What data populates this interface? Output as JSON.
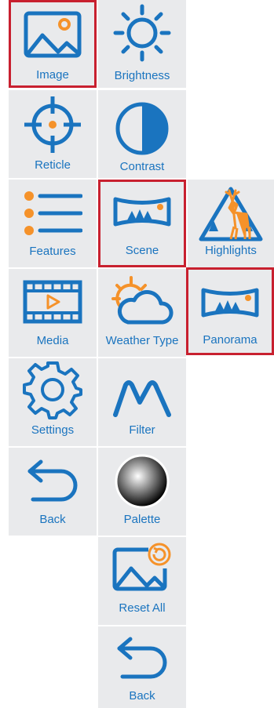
{
  "colors": {
    "blue": "#1a74bf",
    "orange": "#f5922a",
    "tile": "#e9eaec",
    "selected_border": "#c8202f"
  },
  "col1": {
    "image": {
      "label": "Image",
      "icon": "image-icon"
    },
    "reticle": {
      "label": "Reticle",
      "icon": "crosshair-icon"
    },
    "features": {
      "label": "Features",
      "icon": "list-icon"
    },
    "media": {
      "label": "Media",
      "icon": "film-icon"
    },
    "settings": {
      "label": "Settings",
      "icon": "gear-icon"
    },
    "back": {
      "label": "Back",
      "icon": "back-arrow-icon"
    }
  },
  "col2": {
    "brightness": {
      "label": "Brightness",
      "icon": "sun-icon"
    },
    "contrast": {
      "label": "Contrast",
      "icon": "contrast-icon"
    },
    "scene": {
      "label": "Scene",
      "icon": "scene-icon"
    },
    "weather": {
      "label": "Weather Type",
      "icon": "weather-icon"
    },
    "filter": {
      "label": "Filter",
      "icon": "filter-icon"
    },
    "palette": {
      "label": "Palette",
      "icon": "palette-icon"
    },
    "reset": {
      "label": "Reset All",
      "icon": "reset-image-icon"
    },
    "back": {
      "label": "Back",
      "icon": "back-arrow-icon"
    }
  },
  "col3": {
    "highlights": {
      "label": "Highlights",
      "icon": "deer-icon"
    },
    "panorama": {
      "label": "Panorama",
      "icon": "panorama-icon"
    }
  },
  "selected": [
    "Image",
    "Scene",
    "Panorama"
  ]
}
